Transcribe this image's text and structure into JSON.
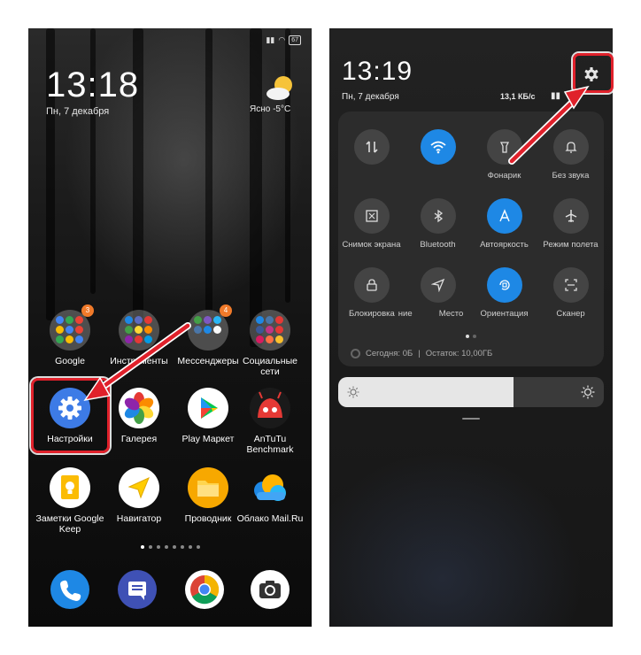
{
  "home": {
    "status": {
      "battery": "67"
    },
    "clock": "13:18",
    "date": "Пн, 7 декабря",
    "weather": {
      "text": "Ясно  -5°C"
    },
    "apps": [
      {
        "label": "Google",
        "badge": "3"
      },
      {
        "label": "Инструменты",
        "badge": ""
      },
      {
        "label": "Мессенджеры",
        "badge": "4"
      },
      {
        "label": "Социальные сети",
        "badge": ""
      },
      {
        "label": "Настройки"
      },
      {
        "label": "Галерея"
      },
      {
        "label": "Play Маркет"
      },
      {
        "label": "AnTuTu Benchmark"
      },
      {
        "label": "Заметки Google Keep"
      },
      {
        "label": "Навигатор"
      },
      {
        "label": "Проводник"
      },
      {
        "label": "Облако Mail.Ru"
      }
    ],
    "page_dots": 8,
    "active_page": 0
  },
  "quick_settings": {
    "clock": "13:19",
    "date": "Пн, 7 декабря",
    "net_speed": "13,1 КБ/с",
    "tiles": [
      {
        "label": "",
        "icon": "mobile-data-icon",
        "on": false
      },
      {
        "label": "",
        "icon": "wifi-icon",
        "on": true
      },
      {
        "label": "Фонарик",
        "icon": "flashlight-icon",
        "on": false
      },
      {
        "label": "Без звука",
        "icon": "bell-icon",
        "on": false
      },
      {
        "label": "Снимок экрана",
        "icon": "screenshot-icon",
        "on": false
      },
      {
        "label": "Bluetooth",
        "icon": "bluetooth-icon",
        "on": false
      },
      {
        "label": "Автояркость",
        "icon": "auto-brightness-icon",
        "on": true
      },
      {
        "label": "Режим полета",
        "icon": "airplane-icon",
        "on": false
      },
      {
        "label": "Блокировка",
        "icon": "lock-icon",
        "on": false
      },
      {
        "label": "ние",
        "icon": "location-icon",
        "on": false
      },
      {
        "label": "Место",
        "icon": "location-arrow-icon",
        "on": false
      },
      {
        "label": "Ориентация",
        "icon": "rotation-icon",
        "on": true
      },
      {
        "label": "Сканер",
        "icon": "scanner-icon",
        "on": false
      }
    ],
    "usage": {
      "today": "Сегодня: 0Б",
      "separator": "|",
      "remaining": "Остаток: 10,00ГБ"
    },
    "brightness_level": 0.66
  },
  "colors": {
    "accent": "#1e88e5",
    "highlight": "#e0212b"
  }
}
